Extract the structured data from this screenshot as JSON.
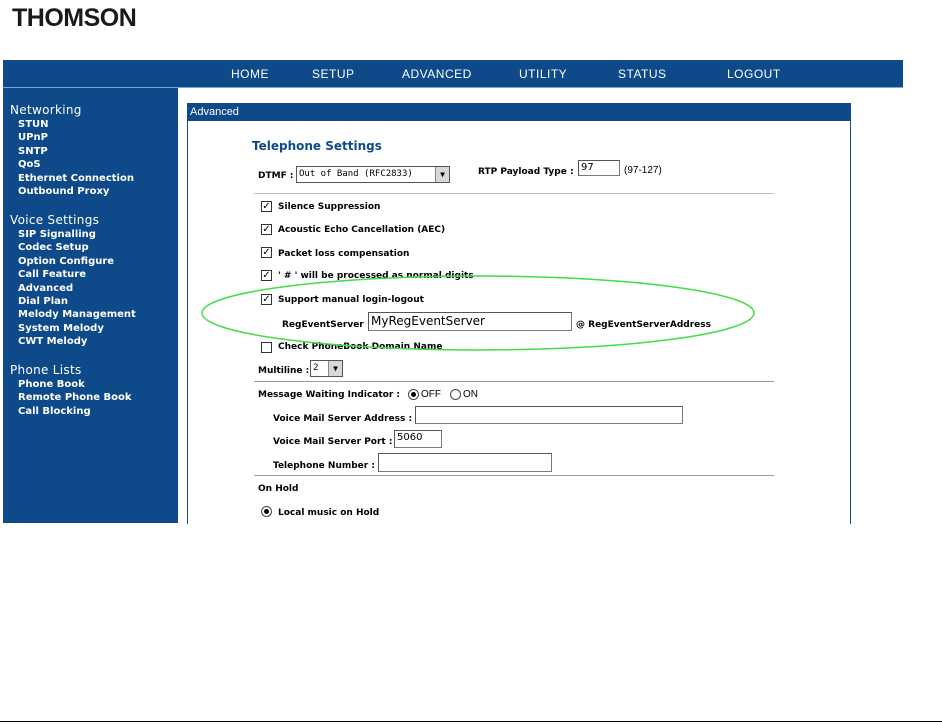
{
  "brand": {
    "logo": "THOMSON"
  },
  "topnav": {
    "items": [
      "HOME",
      "SETUP",
      "ADVANCED",
      "UTILITY",
      "STATUS",
      "LOGOUT"
    ]
  },
  "sidebar": {
    "networking": {
      "title": "Networking",
      "items": [
        "STUN",
        "UPnP",
        "SNTP",
        "QoS",
        "Ethernet Connection",
        "Outbound Proxy"
      ]
    },
    "voice": {
      "title": "Voice Settings",
      "items": [
        "SIP Signalling",
        "Codec Setup",
        "Option Configure",
        "Call Feature",
        "Advanced",
        "Dial Plan",
        "Melody Management",
        "System Melody",
        "CWT Melody"
      ]
    },
    "phone": {
      "title": "Phone Lists",
      "items": [
        "Phone Book",
        "Remote Phone Book",
        "Call Blocking"
      ]
    }
  },
  "panel": {
    "header": "Advanced",
    "title": "Telephone Settings",
    "dtmf": {
      "label": "DTMF :",
      "value": "Out of Band (RFC2833)"
    },
    "rtp": {
      "label": "RTP Payload Type :",
      "value": "97",
      "range": "(97-127)"
    },
    "checks": {
      "silence": {
        "label": "Silence Suppression",
        "checked": true
      },
      "aec": {
        "label": "Acoustic Echo Cancellation (AEC)",
        "checked": true
      },
      "packetloss": {
        "label": "Packet loss compensation",
        "checked": true
      },
      "hash": {
        "label": "' # ' will be processed as normal digits",
        "checked": true
      },
      "manual": {
        "label": "Support manual login-logout",
        "checked": true
      },
      "phonebook": {
        "label": "Check PhoneBook Domain Name",
        "checked": false
      }
    },
    "regevent": {
      "label": "RegEventServer",
      "value": "MyRegEventServer",
      "suffix": "@ RegEventServerAddress"
    },
    "multiline": {
      "label": "Multiline :",
      "value": "2"
    },
    "mwi": {
      "label": "Message Waiting Indicator :",
      "off": "OFF",
      "on": "ON",
      "selected": "OFF"
    },
    "vm_address": {
      "label": "Voice Mail Server Address :",
      "value": ""
    },
    "vm_port": {
      "label": "Voice Mail Server Port :",
      "value": "5060"
    },
    "tel_number": {
      "label": "Telephone Number :",
      "value": ""
    },
    "onhold": {
      "label": "On Hold",
      "option": "Local music on Hold"
    }
  },
  "colors": {
    "nav_bg": "#0e4a8a",
    "highlight_ellipse": "#44dd44",
    "title": "#0e4a8a"
  }
}
